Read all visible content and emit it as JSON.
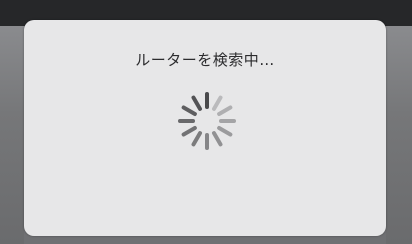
{
  "dialog": {
    "message": "ルーターを検索中…"
  },
  "spinner": {
    "icon": "loading-spinner-icon",
    "color": "#4a4a4c",
    "spoke_count": 12
  },
  "colors": {
    "backdrop": "#6f7073",
    "top_bar": "#262729",
    "dialog_bg": "#e7e7e8",
    "text": "#2c2c2e"
  }
}
